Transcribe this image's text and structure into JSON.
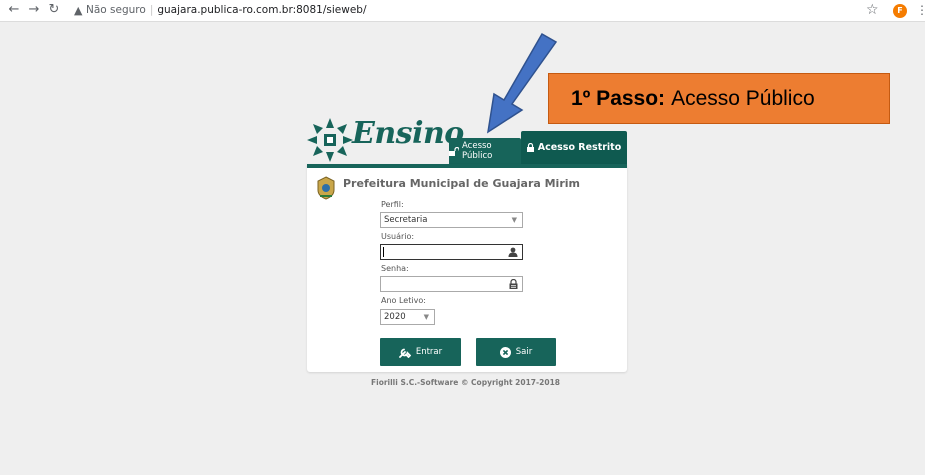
{
  "browser": {
    "back_icon": "arrow-left-icon",
    "forward_icon": "arrow-right-icon",
    "reload_icon": "reload-icon",
    "security_label": "Não seguro",
    "url": "guajara.publica-ro.com.br:8081/sieweb/",
    "profile_initial": "F"
  },
  "header": {
    "logo_text": "Ensino",
    "tab_public_label": "Acesso Público",
    "tab_restricted_label": "Acesso Restrito"
  },
  "panel": {
    "org_name": "Prefeitura Municipal de Guajara Mirim",
    "perfil_label": "Perfil:",
    "perfil_value": "Secretaria",
    "usuario_label": "Usuário:",
    "usuario_value": "",
    "senha_label": "Senha:",
    "senha_value": "",
    "ano_label": "Ano Letivo:",
    "ano_value": "2020",
    "entrar_label": "Entrar",
    "sair_label": "Sair"
  },
  "footer": {
    "copyright": "Fiorilli S.C.-Software © Copyright 2017-2018"
  },
  "annotation": {
    "step_bold": "1º Passo:",
    "step_text": "Acesso Público"
  },
  "colors": {
    "brand_green": "#17645a",
    "callout_orange": "#ed7d31",
    "arrow_blue": "#4472c4"
  }
}
